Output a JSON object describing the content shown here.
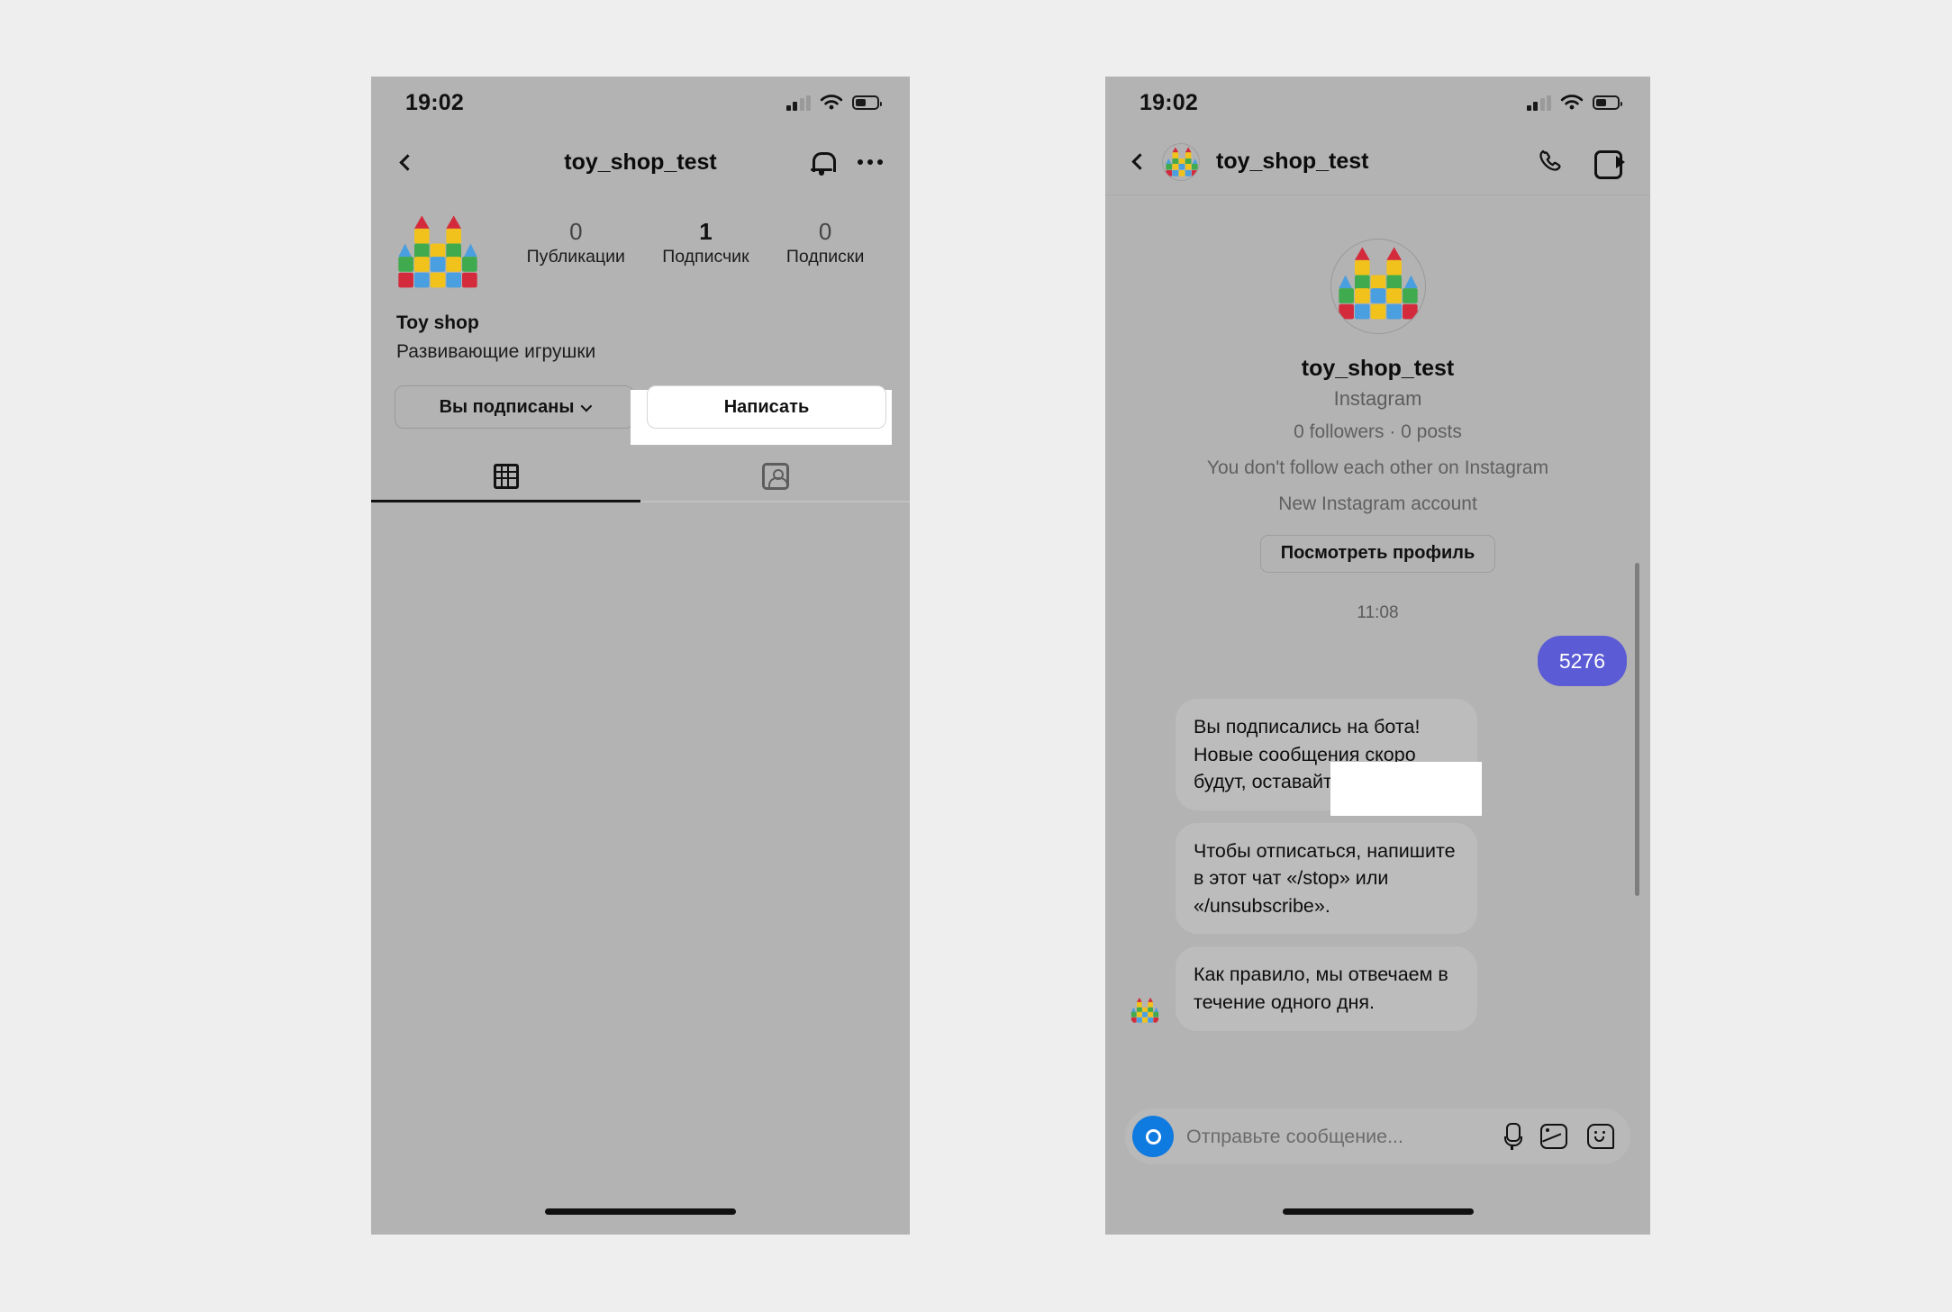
{
  "profile_screen": {
    "status_bar": {
      "time": "19:02",
      "signal_icon": "cellular-signal-icon",
      "wifi_icon": "wifi-icon",
      "battery_icon": "battery-icon"
    },
    "nav": {
      "back_icon": "chevron-left-icon",
      "title": "toy_shop_test",
      "bell_icon": "bell-icon",
      "more_icon": "ellipsis-icon"
    },
    "avatar_icon": "toy-castle-avatar",
    "stats": [
      {
        "value": "0",
        "label": "Публикации"
      },
      {
        "value": "1",
        "label": "Подписчик"
      },
      {
        "value": "0",
        "label": "Подписки"
      }
    ],
    "bio": {
      "name": "Toy shop",
      "description": "Развивающие игрушки"
    },
    "buttons": {
      "following_label": "Вы подписаны",
      "following_caret_icon": "chevron-down-icon",
      "message_label": "Написать"
    },
    "tabs": [
      {
        "icon": "grid-icon",
        "active": true
      },
      {
        "icon": "tagged-person-icon",
        "active": false
      }
    ],
    "home_indicator": "home-indicator"
  },
  "chat_screen": {
    "status_bar": {
      "time": "19:02",
      "signal_icon": "cellular-signal-icon",
      "wifi_icon": "wifi-icon",
      "battery_icon": "battery-icon"
    },
    "nav": {
      "back_icon": "chevron-left-icon",
      "avatar_icon": "toy-castle-avatar",
      "title": "toy_shop_test",
      "call_icon": "phone-icon",
      "video_icon": "video-camera-icon"
    },
    "thread_intro": {
      "avatar_icon": "toy-castle-avatar",
      "username": "toy_shop_test",
      "platform": "Instagram",
      "stats": "0 followers · 0 posts",
      "follow_note": "You don't follow each other on Instagram",
      "account_note": "New Instagram account",
      "view_profile_label": "Посмотреть профиль"
    },
    "timestamp": "11:08",
    "messages": [
      {
        "direction": "out",
        "text": "5276",
        "highlighted": true
      },
      {
        "direction": "in",
        "text": "Вы подписались на бота! Новые сообщения скоро будут, оставайтесь на связи!",
        "avatar": false
      },
      {
        "direction": "in",
        "text": "Чтобы отписаться, напишите в этот чат «/stop» или «/unsubscribe».",
        "avatar": false
      },
      {
        "direction": "in",
        "text": "Как правило, мы отвечаем в течение одного дня.",
        "avatar": true
      }
    ],
    "composer": {
      "camera_icon": "camera-icon",
      "placeholder": "Отправьте сообщение...",
      "mic_icon": "microphone-icon",
      "gallery_icon": "image-icon",
      "sticker_icon": "sticker-icon"
    },
    "scrollbar": "vertical-scrollbar",
    "home_indicator": "home-indicator"
  },
  "colors": {
    "page_background": "#eeeeee",
    "phone_background": "#b3b3b3",
    "outgoing_bubble": "#5b5bd6",
    "incoming_bubble": "#bcbcbc",
    "camera_blue": "#0f7ae0",
    "highlight": "#ffffff"
  }
}
